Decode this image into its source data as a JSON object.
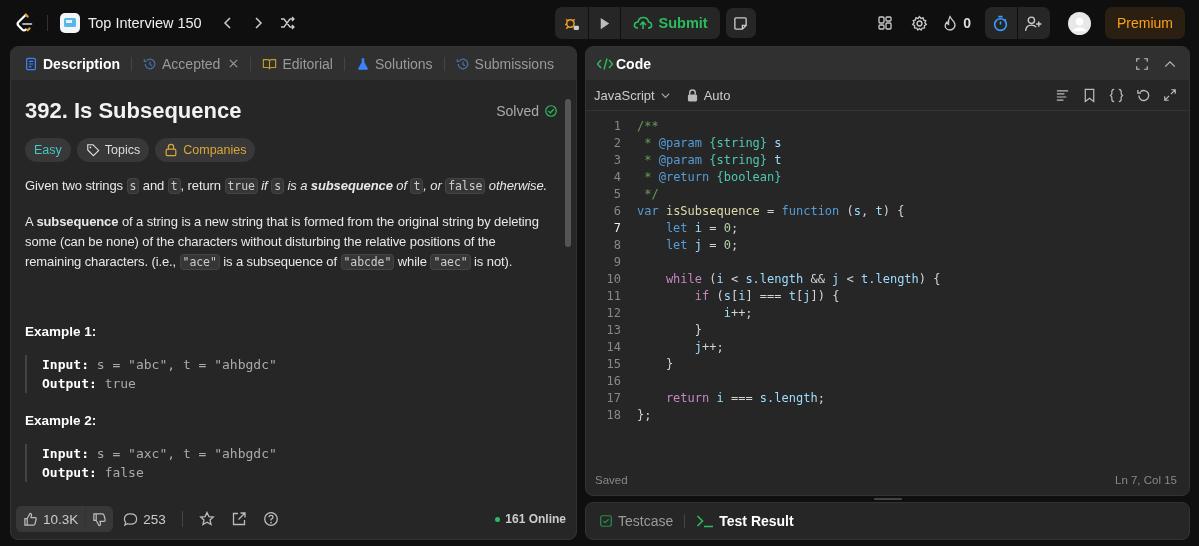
{
  "topbar": {
    "list_title": "Top Interview 150",
    "submit": "Submit",
    "streak": "0",
    "premium": "Premium"
  },
  "left_tabs": [
    {
      "label": "Description",
      "selected": true,
      "closable": false,
      "kind": "doc"
    },
    {
      "label": "Accepted",
      "selected": false,
      "closable": true,
      "kind": "history"
    },
    {
      "label": "Editorial",
      "selected": false,
      "closable": false,
      "kind": "book"
    },
    {
      "label": "Solutions",
      "selected": false,
      "closable": false,
      "kind": "flask"
    },
    {
      "label": "Submissions",
      "selected": false,
      "closable": false,
      "kind": "history"
    }
  ],
  "problem": {
    "title": "392. Is Subsequence",
    "status": "Solved",
    "difficulty": "Easy",
    "tags": [
      {
        "label": "Topics",
        "kind": "topics"
      },
      {
        "label": "Companies",
        "kind": "companies"
      }
    ],
    "paragraphs": [
      [
        {
          "kind": "text",
          "text": "Given two strings "
        },
        {
          "kind": "code",
          "text": "s"
        },
        {
          "kind": "text",
          "text": " and "
        },
        {
          "kind": "code",
          "text": "t"
        },
        {
          "kind": "text",
          "text": ", return "
        },
        {
          "kind": "code",
          "text": "true"
        },
        {
          "kind": "em",
          "text": " if "
        },
        {
          "kind": "code",
          "text": "s"
        },
        {
          "kind": "em",
          "text": " is a **subsequence** of "
        },
        {
          "kind": "code",
          "text": "t"
        },
        {
          "kind": "em",
          "text": ", or "
        },
        {
          "kind": "code",
          "text": "false"
        },
        {
          "kind": "em",
          "text": " otherwise."
        }
      ],
      [
        {
          "kind": "text",
          "text": "A **subsequence** of a string is a new string that is formed from the original string by deleting some (can be none) of the characters without disturbing the relative positions of the remaining characters. (i.e., "
        },
        {
          "kind": "code",
          "text": "\"ace\""
        },
        {
          "kind": "text",
          "text": " is a subsequence of "
        },
        {
          "kind": "code",
          "text": "\"abcde\""
        },
        {
          "kind": "text",
          "text": " while "
        },
        {
          "kind": "code",
          "text": "\"aec\""
        },
        {
          "kind": "text",
          "text": " is not)."
        }
      ]
    ],
    "examples": [
      {
        "heading": "Example 1:",
        "lines": [
          {
            "label": "Input:",
            "value": "s = \"abc\", t = \"ahbgdc\""
          },
          {
            "label": "Output:",
            "value": "true"
          }
        ]
      },
      {
        "heading": "Example 2:",
        "lines": [
          {
            "label": "Input:",
            "value": "s = \"axc\", t = \"ahbgdc\""
          },
          {
            "label": "Output:",
            "value": "false"
          }
        ]
      }
    ]
  },
  "footer": {
    "likes": "10.3K",
    "comments": "253",
    "online": "161 Online"
  },
  "editor": {
    "title": "Code",
    "language": "JavaScript",
    "mode": "Auto",
    "status": "Saved",
    "position": "Ln 7, Col 15",
    "lines": [
      {
        "n": "1",
        "active": false,
        "tokens": [
          {
            "kind": "comment",
            "text": "/**"
          }
        ]
      },
      {
        "n": "2",
        "active": false,
        "tokens": [
          {
            "kind": "comment",
            "text": " *"
          },
          {
            "kind": "doctag",
            "text": " @param"
          },
          {
            "kind": "type",
            "text": " {string}"
          },
          {
            "kind": "ident",
            "text": " s"
          }
        ]
      },
      {
        "n": "3",
        "active": false,
        "tokens": [
          {
            "kind": "comment",
            "text": " *"
          },
          {
            "kind": "doctag",
            "text": " @param"
          },
          {
            "kind": "type",
            "text": " {string}"
          },
          {
            "kind": "ident",
            "text": " t"
          }
        ]
      },
      {
        "n": "4",
        "active": false,
        "tokens": [
          {
            "kind": "comment",
            "text": " *"
          },
          {
            "kind": "doctag",
            "text": " @return"
          },
          {
            "kind": "type",
            "text": " {boolean}"
          }
        ]
      },
      {
        "n": "5",
        "active": false,
        "tokens": [
          {
            "kind": "comment",
            "text": " */"
          }
        ]
      },
      {
        "n": "6",
        "active": false,
        "tokens": [
          {
            "kind": "keyword",
            "text": "var"
          },
          {
            "kind": "function",
            "text": " isSubsequence"
          },
          {
            "kind": "punct",
            "text": " ="
          },
          {
            "kind": "keyword",
            "text": " function"
          },
          {
            "kind": "punct",
            "text": " ("
          },
          {
            "kind": "ident",
            "text": "s"
          },
          {
            "kind": "punct",
            "text": ","
          },
          {
            "kind": "ident",
            "text": " t"
          },
          {
            "kind": "punct",
            "text": ") {"
          }
        ]
      },
      {
        "n": "7",
        "active": true,
        "tokens": [
          {
            "kind": "keyword",
            "text": "    let"
          },
          {
            "kind": "ident",
            "text": " i"
          },
          {
            "kind": "punct",
            "text": " ="
          },
          {
            "kind": "number",
            "text": " 0"
          },
          {
            "kind": "punct",
            "text": ";"
          }
        ]
      },
      {
        "n": "8",
        "active": false,
        "tokens": [
          {
            "kind": "keyword",
            "text": "    let"
          },
          {
            "kind": "ident",
            "text": " j"
          },
          {
            "kind": "punct",
            "text": " ="
          },
          {
            "kind": "number",
            "text": " 0"
          },
          {
            "kind": "punct",
            "text": ";"
          }
        ]
      },
      {
        "n": "9",
        "active": false
      },
      {
        "n": "10",
        "active": false,
        "tokens": [
          {
            "kind": "control",
            "text": "    while"
          },
          {
            "kind": "punct",
            "text": " ("
          },
          {
            "kind": "ident",
            "text": "i"
          },
          {
            "kind": "punct",
            "text": " <"
          },
          {
            "kind": "ident",
            "text": " s.length"
          },
          {
            "kind": "punct",
            "text": " &&"
          },
          {
            "kind": "ident",
            "text": " j"
          },
          {
            "kind": "punct",
            "text": " <"
          },
          {
            "kind": "ident",
            "text": " t.length"
          },
          {
            "kind": "punct",
            "text": ") {"
          }
        ]
      },
      {
        "n": "11",
        "active": false,
        "tokens": [
          {
            "kind": "control",
            "text": "        if"
          },
          {
            "kind": "punct",
            "text": " ("
          },
          {
            "kind": "ident",
            "text": "s"
          },
          {
            "kind": "punct",
            "text": "["
          },
          {
            "kind": "ident",
            "text": "i"
          },
          {
            "kind": "punct",
            "text": "] ==="
          },
          {
            "kind": "ident",
            "text": " t"
          },
          {
            "kind": "punct",
            "text": "["
          },
          {
            "kind": "ident",
            "text": "j"
          },
          {
            "kind": "punct",
            "text": "]) {"
          }
        ]
      },
      {
        "n": "12",
        "active": false,
        "tokens": [
          {
            "kind": "ident",
            "text": "            i"
          },
          {
            "kind": "punct",
            "text": "++;"
          }
        ]
      },
      {
        "n": "13",
        "active": false,
        "tokens": [
          {
            "kind": "punct",
            "text": "        }"
          }
        ]
      },
      {
        "n": "14",
        "active": false,
        "tokens": [
          {
            "kind": "ident",
            "text": "        j"
          },
          {
            "kind": "punct",
            "text": "++;"
          }
        ]
      },
      {
        "n": "15",
        "active": false,
        "tokens": [
          {
            "kind": "punct",
            "text": "    }"
          }
        ]
      },
      {
        "n": "16",
        "active": false
      },
      {
        "n": "17",
        "active": false,
        "tokens": [
          {
            "kind": "control",
            "text": "    return"
          },
          {
            "kind": "ident",
            "text": " i"
          },
          {
            "kind": "punct",
            "text": " ==="
          },
          {
            "kind": "ident",
            "text": " s.length"
          },
          {
            "kind": "punct",
            "text": ";"
          }
        ]
      },
      {
        "n": "18",
        "active": false,
        "tokens": [
          {
            "kind": "punct",
            "text": "};"
          }
        ]
      }
    ]
  },
  "bottom_tabs": [
    {
      "label": "Testcase",
      "selected": false,
      "kind": "check"
    },
    {
      "label": "Test Result",
      "selected": true,
      "kind": "terminal"
    }
  ]
}
